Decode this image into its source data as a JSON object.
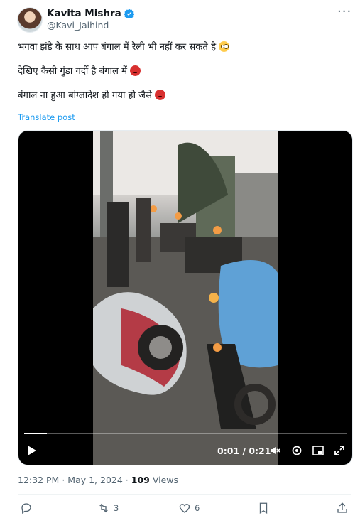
{
  "author": {
    "name": "Kavita Mishra",
    "handle": "@Kavi_Jaihind",
    "verified": true
  },
  "post": {
    "lines": [
      "भगवा झंडे के साथ आप बंगाल में रैली भी नहीं कर सकते है",
      "देखिए कैसी गुंडा गर्दी है बंगाल में",
      "बंगाल ना हुआ बांग्लादेश हो गया हो जैसे"
    ],
    "translate_label": "Translate post"
  },
  "video": {
    "time_display": "0:01 / 0:21",
    "progress_fraction": 0.07
  },
  "meta": {
    "time": "12:32 PM",
    "separator": "·",
    "date": "May 1, 2024",
    "views_count": "109",
    "views_label": "Views"
  },
  "actions": {
    "reposts": "3",
    "likes": "6"
  },
  "colors": {
    "accent": "#1d9bf0",
    "text_primary": "#0f1419",
    "text_secondary": "#536471"
  }
}
